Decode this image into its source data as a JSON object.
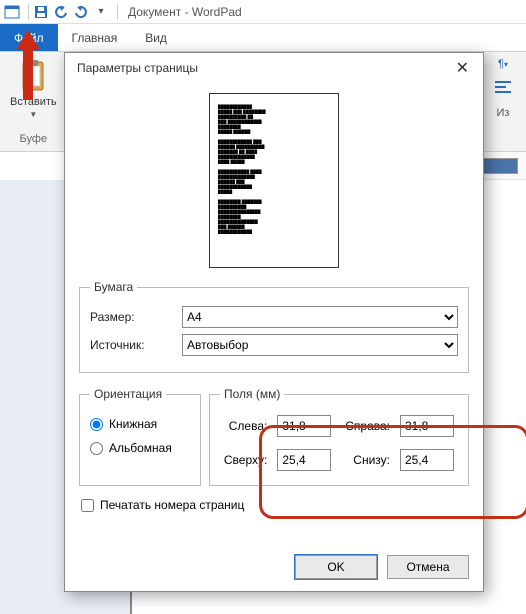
{
  "titlebar": {
    "doc_title": "Документ - WordPad"
  },
  "ribbon": {
    "tabs": {
      "file": "Файл",
      "home": "Главная",
      "view": "Вид"
    },
    "paste_label": "Вставить",
    "clipboard_group": "Буфе",
    "edit_label": "Из"
  },
  "dialog": {
    "title": "Параметры страницы",
    "paper": {
      "legend": "Бумага",
      "size_label": "Размер:",
      "size_value": "A4",
      "source_label": "Источник:",
      "source_value": "Автовыбор"
    },
    "orientation": {
      "legend": "Ориентация",
      "portrait": "Книжная",
      "landscape": "Альбомная"
    },
    "margins": {
      "legend": "Поля (мм)",
      "left_label": "Слева:",
      "left_value": "31,8",
      "right_label": "Справа:",
      "right_value": "31,8",
      "top_label": "Сверху:",
      "top_value": "25,4",
      "bottom_label": "Снизу:",
      "bottom_value": "25,4"
    },
    "print_page_numbers": "Печатать номера страниц",
    "ok": "OK",
    "cancel": "Отмена"
  }
}
